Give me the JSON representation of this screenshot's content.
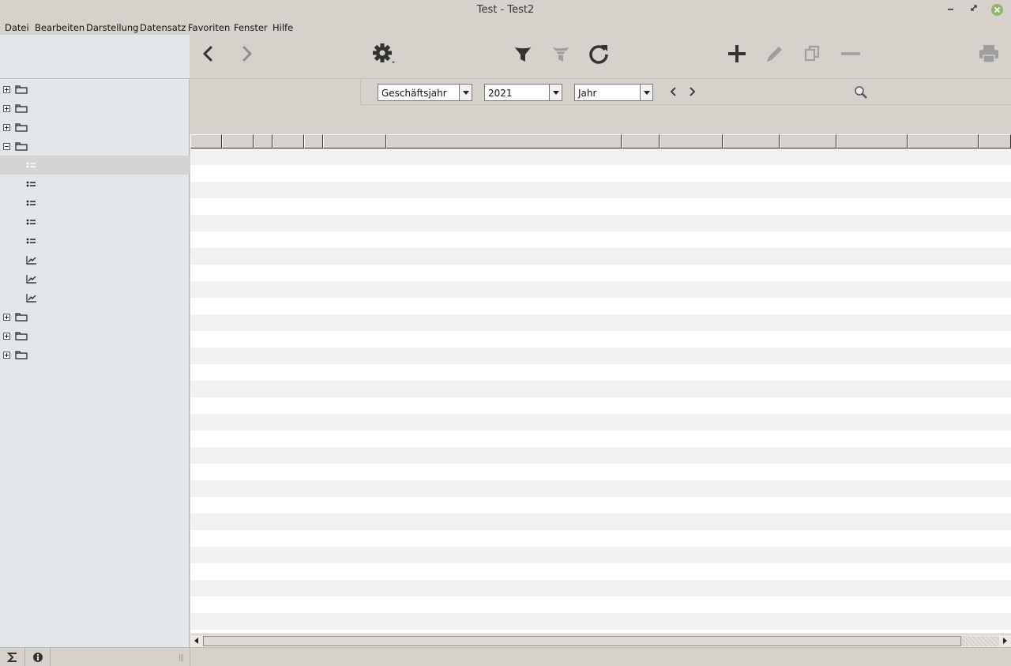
{
  "window": {
    "title": "Test - Test2"
  },
  "menubar": {
    "items": [
      "Datei",
      "Bearbeiten",
      "Darstellung",
      "Datensatz",
      "Favoriten",
      "Fenster",
      "Hilfe"
    ]
  },
  "toolbar": {
    "icons": [
      "back-icon",
      "forward-icon",
      "gear-icon",
      "filter-icon",
      "filter-remove-icon",
      "refresh-icon",
      "add-icon",
      "edit-icon",
      "copy-icon",
      "remove-icon",
      "print-icon"
    ]
  },
  "filters": {
    "period_type": "Geschäftsjahr",
    "year": "2021",
    "granularity": "Jahr"
  },
  "sidebar": {
    "tree": [
      {
        "kind": "folder",
        "state": "collapsed",
        "icon": "folder-icon"
      },
      {
        "kind": "folder",
        "state": "collapsed",
        "icon": "folder-icon"
      },
      {
        "kind": "folder",
        "state": "collapsed",
        "icon": "folder-icon"
      },
      {
        "kind": "folder",
        "state": "expanded",
        "icon": "folder-icon"
      },
      {
        "kind": "list",
        "icon": "list-icon",
        "selected": true
      },
      {
        "kind": "list",
        "icon": "list-icon"
      },
      {
        "kind": "list",
        "icon": "list-icon"
      },
      {
        "kind": "list",
        "icon": "list-icon"
      },
      {
        "kind": "list",
        "icon": "list-icon"
      },
      {
        "kind": "chart",
        "icon": "chart-icon"
      },
      {
        "kind": "chart",
        "icon": "chart-icon"
      },
      {
        "kind": "chart",
        "icon": "chart-icon"
      },
      {
        "kind": "folder",
        "state": "collapsed",
        "icon": "folder-icon"
      },
      {
        "kind": "folder",
        "state": "collapsed",
        "icon": "folder-icon"
      },
      {
        "kind": "folder",
        "state": "collapsed",
        "icon": "folder-icon"
      }
    ]
  },
  "grid": {
    "column_count": 14,
    "row_count": 29
  },
  "statusbar": {
    "icons": [
      "sigma-icon",
      "info-icon"
    ]
  },
  "colors": {
    "close_button": "#8fb56a",
    "selected_row": "#d4d4d4",
    "sidebar_bg": "#e2e7ea",
    "stripe": "#f0f1f0"
  }
}
